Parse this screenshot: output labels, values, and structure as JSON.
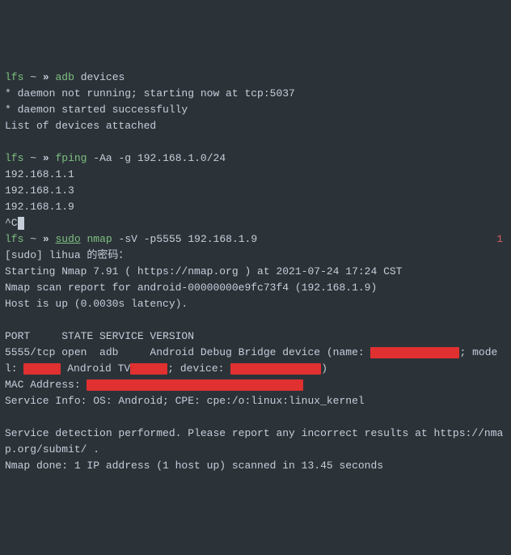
{
  "prompts": {
    "user": "lfs",
    "path": "~",
    "sep": "»"
  },
  "cmd1": {
    "prog": "adb",
    "args": "devices"
  },
  "out1": {
    "l1": "* daemon not running; starting now at tcp:5037",
    "l2": "* daemon started successfully",
    "l3": "List of devices attached"
  },
  "cmd2": {
    "prog": "fping",
    "args": "-Aa -g 192.168.1.0/24"
  },
  "out2": {
    "l1": "192.168.1.1",
    "l2": "192.168.1.3",
    "l3": "192.168.1.9",
    "l4": "^C"
  },
  "cmd3": {
    "sudo": "sudo",
    "prog": "nmap",
    "args": "-sV -p5555 192.168.1.9",
    "exit": "1"
  },
  "out3": {
    "l1": "[sudo] lihua 的密码：",
    "l2": "Starting Nmap 7.91 ( https://nmap.org ) at 2021-07-24 17:24 CST",
    "l3": "Nmap scan report for android-00000000e9fc73f4 (192.168.1.9)",
    "l4": "Host is up (0.0030s latency).",
    "l5": "PORT     STATE SERVICE VERSION",
    "l6a": "5555/tcp open  adb     Android Debug Bridge device (name: ",
    "l6b": "; model:",
    "l7a": " Android TV",
    "l7b": "; device: ",
    "l7c": ")",
    "l8a": "MAC Address: ",
    "l9": "Service Info: OS: Android; CPE: cpe:/o:linux:linux_kernel",
    "l10": "Service detection performed. Please report any incorrect results at https://nmap.org/submit/ .",
    "l11": "Nmap done: 1 IP address (1 host up) scanned in 13.45 seconds"
  }
}
